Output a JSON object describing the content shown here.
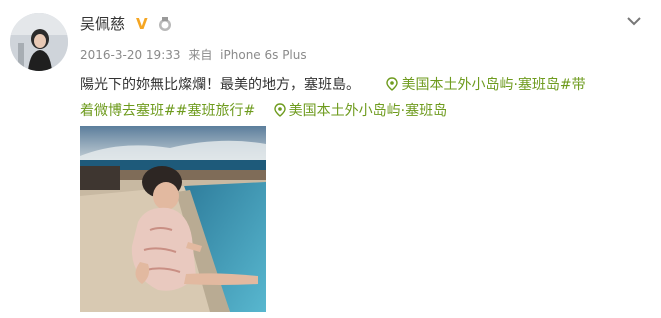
{
  "post": {
    "author": "吴佩慈",
    "verified_badge": "V",
    "date": "2016-3-20 19:33",
    "source_prefix": "来自",
    "device": "iPhone 6s Plus",
    "text": "陽光下的妳無比燦爛！最美的地方，塞班島。",
    "location_1": "美国本土外小岛屿·塞班岛",
    "tags_line1": "#带",
    "tags_line2_start": "着微博去塞班#",
    "tag_2": "#塞班旅行#",
    "location_2": "美国本土外小岛屿·塞班岛"
  },
  "icons": {
    "avatar": "avatar-photo",
    "medal": "medal-icon",
    "chevron": "chevron-down-icon",
    "location": "location-pin-icon"
  },
  "colors": {
    "link": "#6e9b1e",
    "badge": "#f5a623",
    "meta": "#8a8a8a"
  }
}
